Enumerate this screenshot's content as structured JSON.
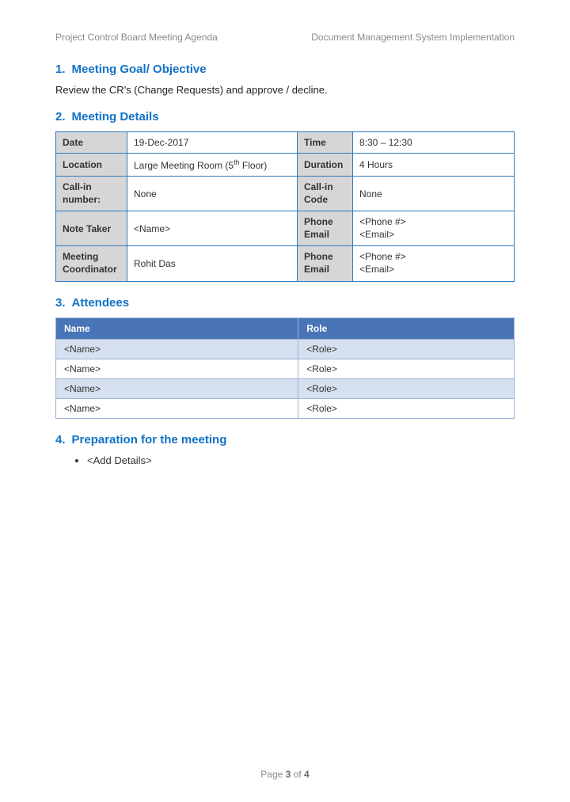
{
  "header": {
    "left": "Project Control Board Meeting Agenda",
    "right": "Document Management System Implementation"
  },
  "sections": {
    "s1": {
      "num": "1.",
      "title": "Meeting Goal/ Objective"
    },
    "s2": {
      "num": "2.",
      "title": "Meeting Details"
    },
    "s3": {
      "num": "3.",
      "title": "Attendees"
    },
    "s4": {
      "num": "4.",
      "title": "Preparation for the meeting"
    }
  },
  "objective_text": "Review the CR's (Change Requests) and approve / decline.",
  "details": {
    "labels": {
      "date": "Date",
      "time": "Time",
      "location": "Location",
      "duration": "Duration",
      "callin": "Call-in number:",
      "callcode": "Call-in Code",
      "notetaker": "Note Taker",
      "phoneemail": "Phone Email",
      "coordinator": "Meeting Coordinator"
    },
    "values": {
      "date": "19-Dec-2017",
      "time": "8:30 – 12:30",
      "location_pre": "Large Meeting Room (5",
      "location_sup": "th",
      "location_post": " Floor)",
      "duration": "4 Hours",
      "callin": "None",
      "callcode": "None",
      "notetaker": "<Name>",
      "phone_line": "<Phone #>",
      "email_line": "<Email>",
      "coordinator": "Rohit Das"
    }
  },
  "attendees": {
    "headers": {
      "name": "Name",
      "role": "Role"
    },
    "rows": [
      {
        "name": "<Name>",
        "role": "<Role>"
      },
      {
        "name": "<Name>",
        "role": "<Role>"
      },
      {
        "name": "<Name>",
        "role": "<Role>"
      },
      {
        "name": "<Name>",
        "role": "<Role>"
      }
    ]
  },
  "preparation": {
    "item": "<Add Details>"
  },
  "footer": {
    "prefix": "Page ",
    "current": "3",
    "middle": " of ",
    "total": "4"
  }
}
